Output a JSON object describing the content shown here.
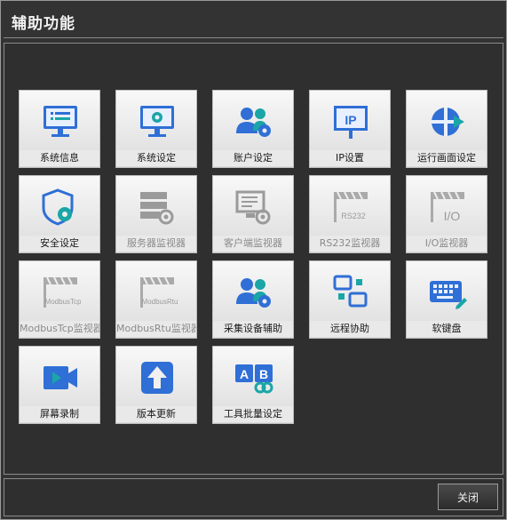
{
  "window": {
    "title": "辅助功能"
  },
  "tiles": [
    {
      "label": "系统信息",
      "icon": "monitor-list-icon"
    },
    {
      "label": "系统设定",
      "icon": "monitor-gear-icon"
    },
    {
      "label": "账户设定",
      "icon": "users-gear-icon"
    },
    {
      "label": "IP设置",
      "icon": "ip-board-icon"
    },
    {
      "label": "运行画面设定",
      "icon": "screen-run-icon"
    },
    {
      "label": "安全设定",
      "icon": "shield-gear-icon"
    },
    {
      "label": "服务器监视器",
      "icon": "server-monitor-icon"
    },
    {
      "label": "客户端监视器",
      "icon": "client-monitor-icon"
    },
    {
      "label": "RS232监视器",
      "icon": "rs232-monitor-icon",
      "icon_text": "RS232"
    },
    {
      "label": "I/O监视器",
      "icon": "io-monitor-icon",
      "icon_text": "I/O"
    },
    {
      "label": "ModbusTcp监视器",
      "icon": "modbustcp-monitor-icon",
      "icon_text": "ModbusTcp"
    },
    {
      "label": "ModbusRtu监视器",
      "icon": "modbusrtu-monitor-icon",
      "icon_text": "ModbusRtu"
    },
    {
      "label": "采集设备辅助",
      "icon": "users-gear-icon"
    },
    {
      "label": "远程协助",
      "icon": "remote-assist-icon"
    },
    {
      "label": "软键盘",
      "icon": "keyboard-icon"
    },
    {
      "label": "屏幕录制",
      "icon": "video-record-icon"
    },
    {
      "label": "版本更新",
      "icon": "upload-arrow-icon"
    },
    {
      "label": "工具批量设定",
      "icon": "ab-link-icon"
    }
  ],
  "footer": {
    "close_label": "关闭"
  },
  "colors": {
    "accent": "#2f6fd6",
    "teal": "#1aa6a6",
    "disabled": "#9a9a9a"
  }
}
